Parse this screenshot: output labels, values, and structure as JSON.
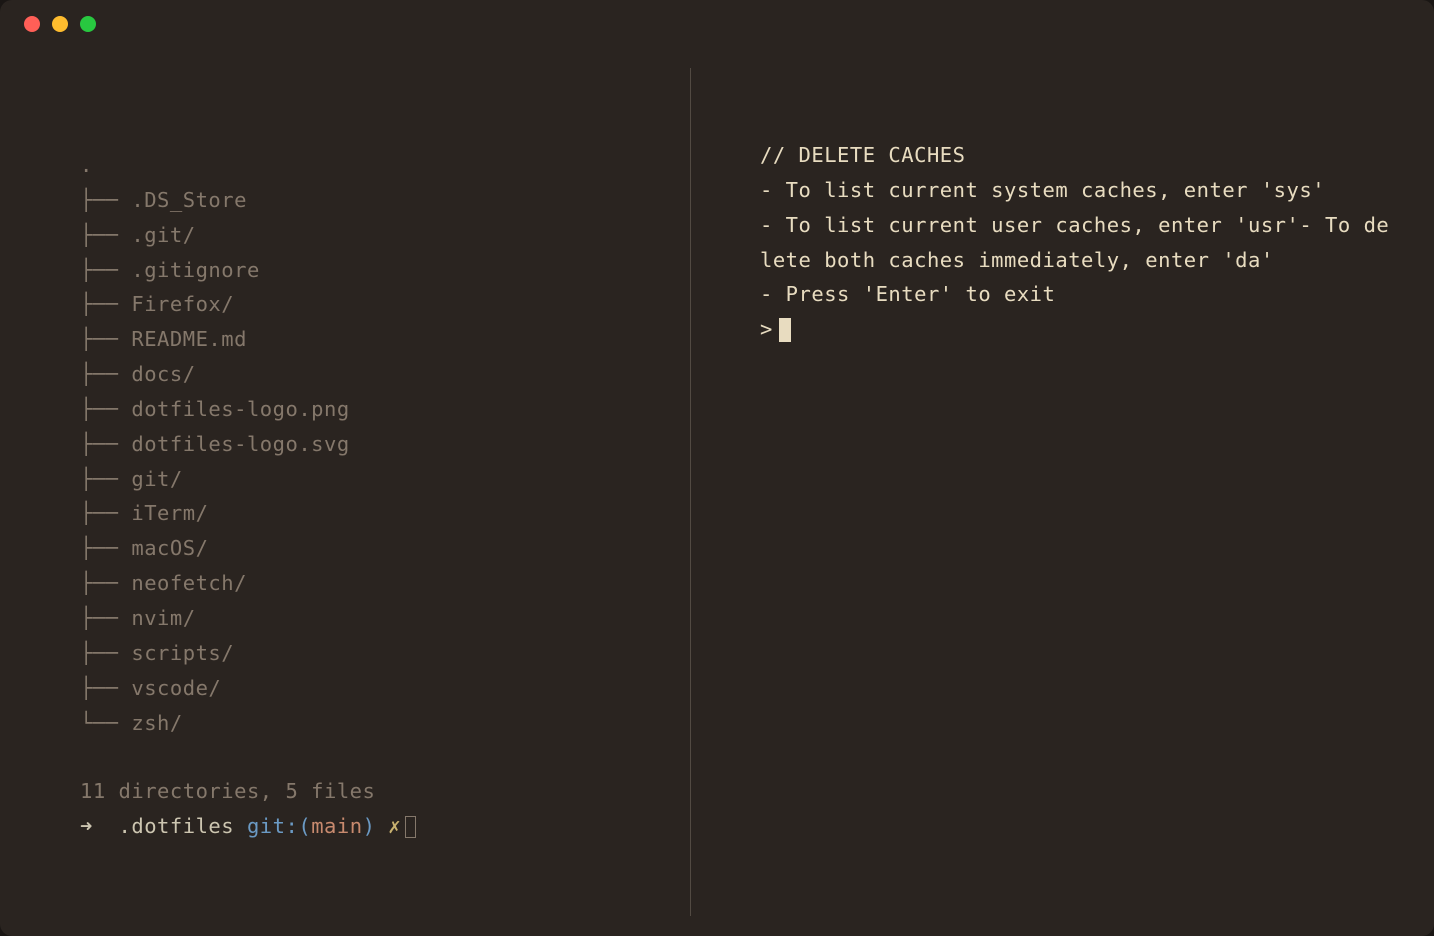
{
  "left_pane": {
    "tree_root": ".",
    "tree_items": [
      ".DS_Store",
      ".git/",
      ".gitignore",
      "Firefox/",
      "README.md",
      "docs/",
      "dotfiles-logo.png",
      "dotfiles-logo.svg",
      "git/",
      "iTerm/",
      "macOS/",
      "neofetch/",
      "nvim/",
      "scripts/",
      "vscode/",
      "zsh/"
    ],
    "summary": "11 directories, 5 files",
    "prompt": {
      "arrow": "➜",
      "cwd": ".dotfiles",
      "git_label": "git:",
      "paren_open": "(",
      "branch": "main",
      "paren_close": ")",
      "dirty": "✗"
    }
  },
  "right_pane": {
    "header": "// DELETE CACHES",
    "lines": [
      "- To list current system caches, enter 'sys'",
      "- To list current user caches, enter 'usr'- To delete both caches immediately, enter 'da'",
      "- Press 'Enter' to exit"
    ],
    "prompt_symbol": ">"
  }
}
